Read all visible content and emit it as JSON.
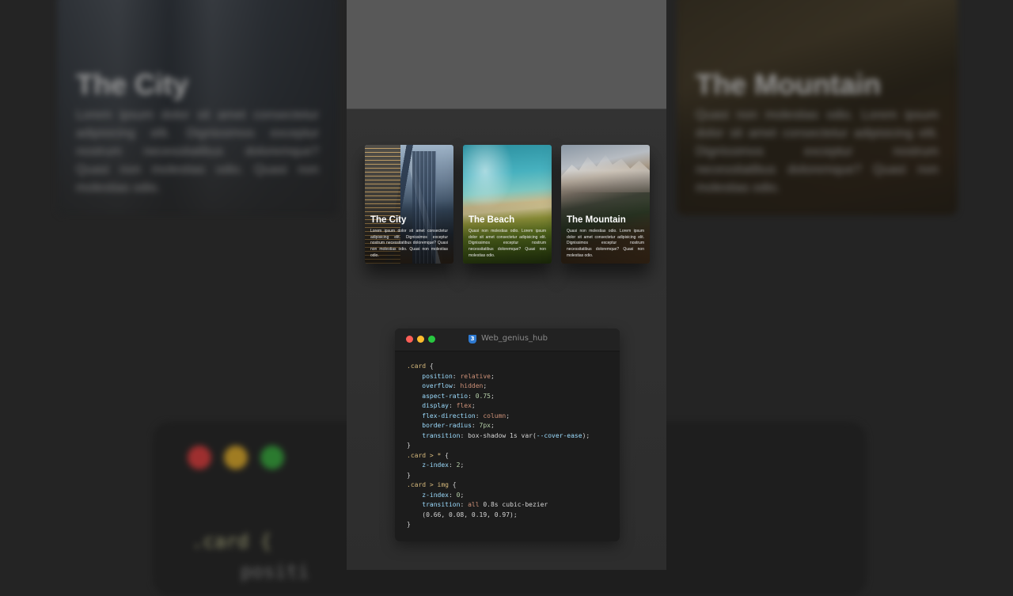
{
  "background": {
    "left_card": {
      "title": "The City",
      "text": "Lorem ipsum dolor sit amet consectetur adipisicing elit. Dignissimos exceptur nostrum necessitatibus doloremque? Quasi non molestias odio. Quasi non molestias odio."
    },
    "right_card": {
      "title": "The Mountain",
      "text": "Quasi non molestias odio. Lorem ipsum dolor sit amet consectetur adipisicing elit. Dignissimos exceptur nostrum necessitatibus doloremque? Quasi non molestias odio."
    },
    "code_snippet": ".card {",
    "code_snippet_2": "positi"
  },
  "cards": [
    {
      "title": "The City",
      "text": "Lorem ipsum dolor sit amet consectetur adipisicing elit. Dignissimos exceptur nostrum necessitatibus doloremque? Quasi non molestias odio. Quasi non molestias odio."
    },
    {
      "title": "The Beach",
      "text": "Quasi non molestias odio. Lorem ipsum dolor sit amet consectetur adipisicing elit. Dignissimos exceptur nostrum necessitatibus doloremque? Quasi non molestias odio."
    },
    {
      "title": "The Mountain",
      "text": "Quasi non molestias odio. Lorem ipsum dolor sit amet consectetur adipisicing elit. Dignissimos exceptur nostrum necessitatibus doloremque? Quasi non molestias odio."
    }
  ],
  "code_window": {
    "title": "Web_genius_hub",
    "icon": "css3-icon",
    "icon_glyph": "3",
    "lines": [
      [
        {
          "t": ".card",
          "c": "sel"
        },
        {
          "t": " {",
          "c": "pun"
        }
      ],
      [
        {
          "t": "    position",
          "c": "prop"
        },
        {
          "t": ": ",
          "c": "pun"
        },
        {
          "t": "relative",
          "c": "val"
        },
        {
          "t": ";",
          "c": "pun"
        }
      ],
      [
        {
          "t": "    overflow",
          "c": "prop"
        },
        {
          "t": ": ",
          "c": "pun"
        },
        {
          "t": "hidden",
          "c": "val"
        },
        {
          "t": ";",
          "c": "pun"
        }
      ],
      [
        {
          "t": "    aspect-ratio",
          "c": "prop"
        },
        {
          "t": ": ",
          "c": "pun"
        },
        {
          "t": "0.75",
          "c": "num"
        },
        {
          "t": ";",
          "c": "pun"
        }
      ],
      [
        {
          "t": "    display",
          "c": "prop"
        },
        {
          "t": ": ",
          "c": "pun"
        },
        {
          "t": "flex",
          "c": "val"
        },
        {
          "t": ";",
          "c": "pun"
        }
      ],
      [
        {
          "t": "    flex-direction",
          "c": "prop"
        },
        {
          "t": ": ",
          "c": "pun"
        },
        {
          "t": "column",
          "c": "val"
        },
        {
          "t": ";",
          "c": "pun"
        }
      ],
      [
        {
          "t": "    border-radius",
          "c": "prop"
        },
        {
          "t": ": ",
          "c": "pun"
        },
        {
          "t": "7px",
          "c": "num"
        },
        {
          "t": ";",
          "c": "pun"
        }
      ],
      [
        {
          "t": "    transition",
          "c": "prop"
        },
        {
          "t": ": box-shadow 1s var(",
          "c": "pun"
        },
        {
          "t": "--cover-ease",
          "c": "prop"
        },
        {
          "t": ");",
          "c": "pun"
        }
      ],
      [
        {
          "t": "}",
          "c": "pun"
        }
      ],
      [
        {
          "t": ".card > *",
          "c": "sel"
        },
        {
          "t": " {",
          "c": "pun"
        }
      ],
      [
        {
          "t": "    z-index",
          "c": "prop"
        },
        {
          "t": ": ",
          "c": "pun"
        },
        {
          "t": "2",
          "c": "num"
        },
        {
          "t": ";",
          "c": "pun"
        }
      ],
      [
        {
          "t": "}",
          "c": "pun"
        }
      ],
      [
        {
          "t": ".card > img",
          "c": "sel"
        },
        {
          "t": " {",
          "c": "pun"
        }
      ],
      [
        {
          "t": "    z-index",
          "c": "prop"
        },
        {
          "t": ": ",
          "c": "pun"
        },
        {
          "t": "0",
          "c": "num"
        },
        {
          "t": ";",
          "c": "pun"
        }
      ],
      [
        {
          "t": "    transition",
          "c": "prop"
        },
        {
          "t": ": ",
          "c": "pun"
        },
        {
          "t": "all",
          "c": "val"
        },
        {
          "t": " 0.8s cubic-bezier",
          "c": "pun"
        }
      ],
      [
        {
          "t": "    (0.66, 0.08, 0.19, 0.97);",
          "c": "pun"
        }
      ],
      [
        {
          "t": "}",
          "c": "pun"
        }
      ]
    ]
  },
  "colors": {
    "dot_red": "#fe5f57",
    "dot_yellow": "#febc2e",
    "dot_green": "#28c840",
    "css_icon": "#2f7ad1"
  }
}
